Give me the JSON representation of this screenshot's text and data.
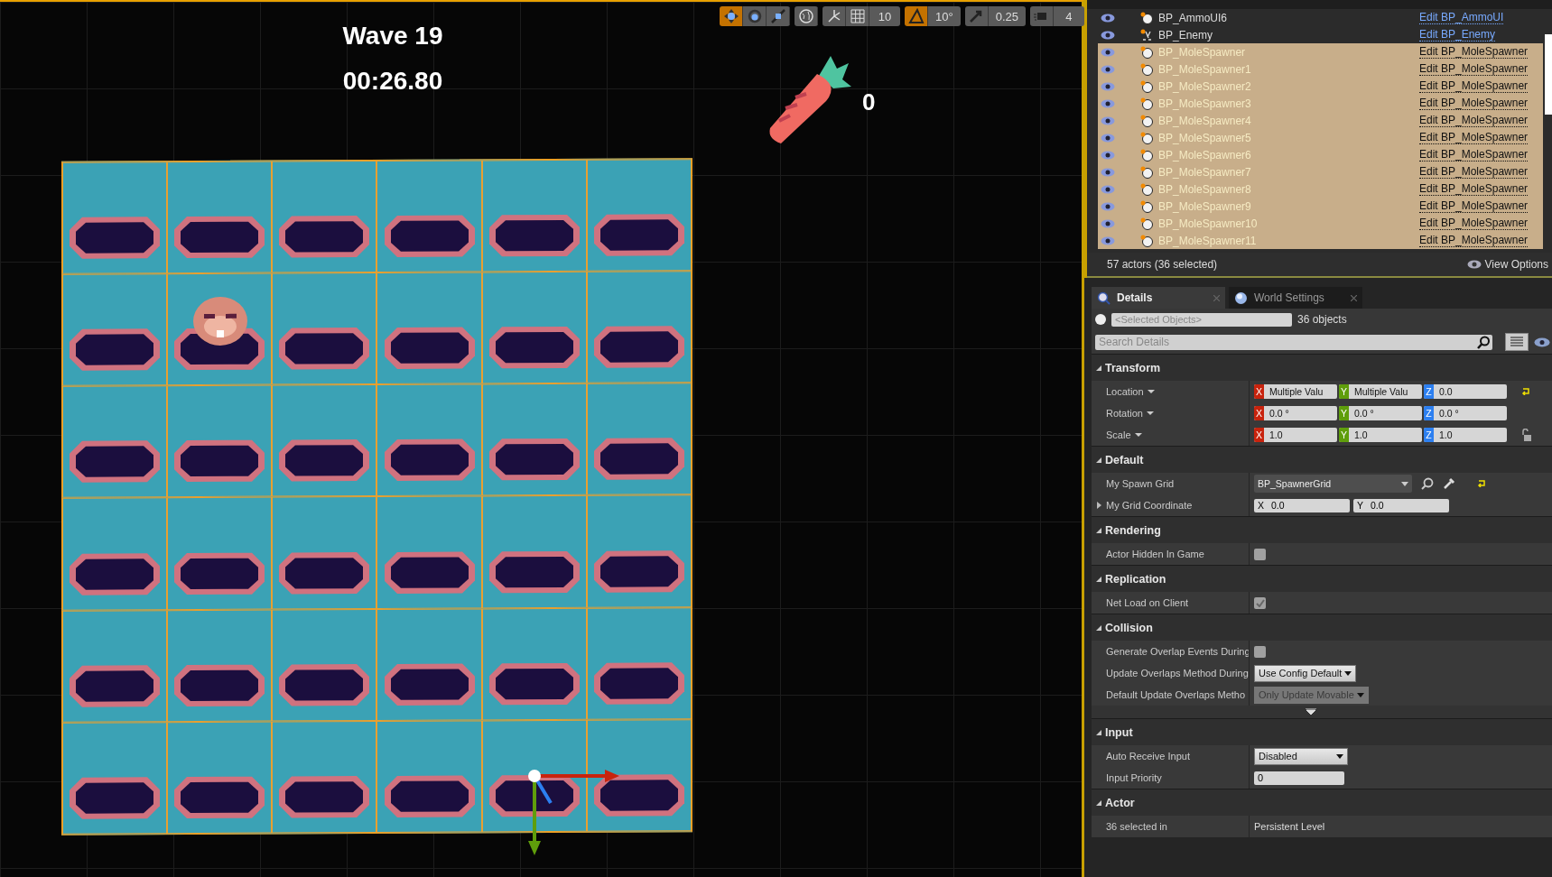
{
  "viewport": {
    "hud": {
      "wave": "Wave 19",
      "timer": "00:26.80",
      "score": "0"
    },
    "toolbar": [
      {
        "items": [
          {
            "kind": "move",
            "selected": true
          },
          {
            "kind": "rotate",
            "selected": false
          },
          {
            "kind": "scale",
            "selected": false
          }
        ]
      },
      {
        "items": [
          {
            "kind": "world",
            "selected": false
          }
        ]
      },
      {
        "items": [
          {
            "kind": "surface",
            "selected": false
          },
          {
            "kind": "grid",
            "selected": false
          },
          {
            "kind": "value",
            "text": "10"
          }
        ]
      },
      {
        "items": [
          {
            "kind": "angle",
            "selected": true
          },
          {
            "kind": "value",
            "text": "10°"
          }
        ]
      },
      {
        "items": [
          {
            "kind": "scale-snap",
            "selected": false
          },
          {
            "kind": "value",
            "text": "0.25"
          }
        ]
      },
      {
        "items": [
          {
            "kind": "camera",
            "selected": false
          },
          {
            "kind": "value",
            "text": "4"
          }
        ]
      }
    ],
    "board": {
      "cells": [
        {
          "mole": false
        },
        {
          "mole": false
        },
        {
          "mole": false
        },
        {
          "mole": false
        },
        {
          "mole": false
        },
        {
          "mole": false
        },
        {
          "mole": false
        },
        {
          "mole": true
        },
        {
          "mole": false
        },
        {
          "mole": false
        },
        {
          "mole": false
        },
        {
          "mole": false
        },
        {
          "mole": false
        },
        {
          "mole": false
        },
        {
          "mole": false
        },
        {
          "mole": false
        },
        {
          "mole": false
        },
        {
          "mole": false
        },
        {
          "mole": false
        },
        {
          "mole": false
        },
        {
          "mole": false
        },
        {
          "mole": false
        },
        {
          "mole": false
        },
        {
          "mole": false
        },
        {
          "mole": false
        },
        {
          "mole": false
        },
        {
          "mole": false
        },
        {
          "mole": false
        },
        {
          "mole": false
        },
        {
          "mole": false
        },
        {
          "mole": false
        },
        {
          "mole": false
        },
        {
          "mole": false
        },
        {
          "mole": false
        },
        {
          "mole": false
        },
        {
          "mole": false
        }
      ]
    }
  },
  "outliner": {
    "rows": [
      {
        "name": "BP_AmmoUI6",
        "link": "Edit BP_AmmoUI",
        "kind": "actor",
        "selected": false
      },
      {
        "name": "BP_Enemy",
        "link": "Edit BP_Enemy",
        "kind": "pawn",
        "selected": false
      },
      {
        "name": "BP_MoleSpawner",
        "link": "Edit BP_MoleSpawner",
        "kind": "actor",
        "selected": true
      },
      {
        "name": "BP_MoleSpawner1",
        "link": "Edit BP_MoleSpawner",
        "kind": "actor",
        "selected": true
      },
      {
        "name": "BP_MoleSpawner2",
        "link": "Edit BP_MoleSpawner",
        "kind": "actor",
        "selected": true
      },
      {
        "name": "BP_MoleSpawner3",
        "link": "Edit BP_MoleSpawner",
        "kind": "actor",
        "selected": true
      },
      {
        "name": "BP_MoleSpawner4",
        "link": "Edit BP_MoleSpawner",
        "kind": "actor",
        "selected": true
      },
      {
        "name": "BP_MoleSpawner5",
        "link": "Edit BP_MoleSpawner",
        "kind": "actor",
        "selected": true
      },
      {
        "name": "BP_MoleSpawner6",
        "link": "Edit BP_MoleSpawner",
        "kind": "actor",
        "selected": true
      },
      {
        "name": "BP_MoleSpawner7",
        "link": "Edit BP_MoleSpawner",
        "kind": "actor",
        "selected": true
      },
      {
        "name": "BP_MoleSpawner8",
        "link": "Edit BP_MoleSpawner",
        "kind": "actor",
        "selected": true
      },
      {
        "name": "BP_MoleSpawner9",
        "link": "Edit BP_MoleSpawner",
        "kind": "actor",
        "selected": true
      },
      {
        "name": "BP_MoleSpawner10",
        "link": "Edit BP_MoleSpawner",
        "kind": "actor",
        "selected": true
      },
      {
        "name": "BP_MoleSpawner11",
        "link": "Edit BP_MoleSpawner",
        "kind": "actor",
        "selected": true
      }
    ],
    "status": "57 actors (36 selected)",
    "view_options": "View Options"
  },
  "details": {
    "tabs": [
      {
        "label": "Details",
        "kind": "details",
        "selected": true
      },
      {
        "label": "World Settings",
        "kind": "world",
        "selected": false
      }
    ],
    "selection_placeholder": "<Selected Objects>",
    "object_count": "36 objects",
    "search_placeholder": "Search Details",
    "sections": [
      {
        "title": "Transform",
        "expanded": true,
        "rows": [
          {
            "label": "Location",
            "kind": "vector",
            "fields": [
              "Multiple Valu",
              "Multiple Valu",
              "0.0"
            ],
            "axes": [
              "X",
              "Y",
              "Z"
            ],
            "reset_button": true
          },
          {
            "label": "Rotation",
            "kind": "vector",
            "fields": [
              "0.0 °",
              "0.0 °",
              "0.0 °"
            ],
            "axes": [
              "X",
              "Y",
              "Z"
            ]
          },
          {
            "label": "Scale",
            "kind": "vector",
            "fields": [
              "1.0",
              "1.0",
              "1.0"
            ],
            "axes": [
              "X",
              "Y",
              "Z"
            ],
            "lock_button": true
          }
        ]
      },
      {
        "title": "Default",
        "expanded": true,
        "rows": [
          {
            "label": "My Spawn Grid",
            "kind": "asset",
            "value": "BP_SpawnerGrid",
            "reset_button": true
          },
          {
            "label": "My Grid Coordinate",
            "kind": "vector2",
            "expanded": false,
            "fields": [
              "0.0",
              "0.0"
            ],
            "axes": [
              "X",
              "Y"
            ]
          }
        ]
      },
      {
        "title": "Rendering",
        "expanded": true,
        "rows": [
          {
            "label": "Actor Hidden In Game",
            "kind": "checkbox",
            "checked": false
          }
        ]
      },
      {
        "title": "Replication",
        "expanded": true,
        "rows": [
          {
            "label": "Net Load on Client",
            "kind": "checkbox",
            "checked": true
          }
        ]
      },
      {
        "title": "Collision",
        "expanded": true,
        "advanced": true,
        "rows": [
          {
            "label": "Generate Overlap Events During",
            "kind": "checkbox",
            "checked": false
          },
          {
            "label": "Update Overlaps Method During",
            "kind": "combo",
            "value": "Use Config Default",
            "disabled": false
          },
          {
            "label": "Default Update Overlaps Metho",
            "kind": "combo",
            "value": "Only Update Movable",
            "disabled": true
          }
        ]
      },
      {
        "title": "Input",
        "expanded": true,
        "rows": [
          {
            "label": "Auto Receive Input",
            "kind": "dropdown",
            "value": "Disabled"
          },
          {
            "label": "Input Priority",
            "kind": "number",
            "value": "0"
          }
        ]
      },
      {
        "title": "Actor",
        "expanded": true,
        "rows": [
          {
            "label": "36 selected in",
            "kind": "text",
            "value": "Persistent Level"
          }
        ]
      }
    ]
  }
}
